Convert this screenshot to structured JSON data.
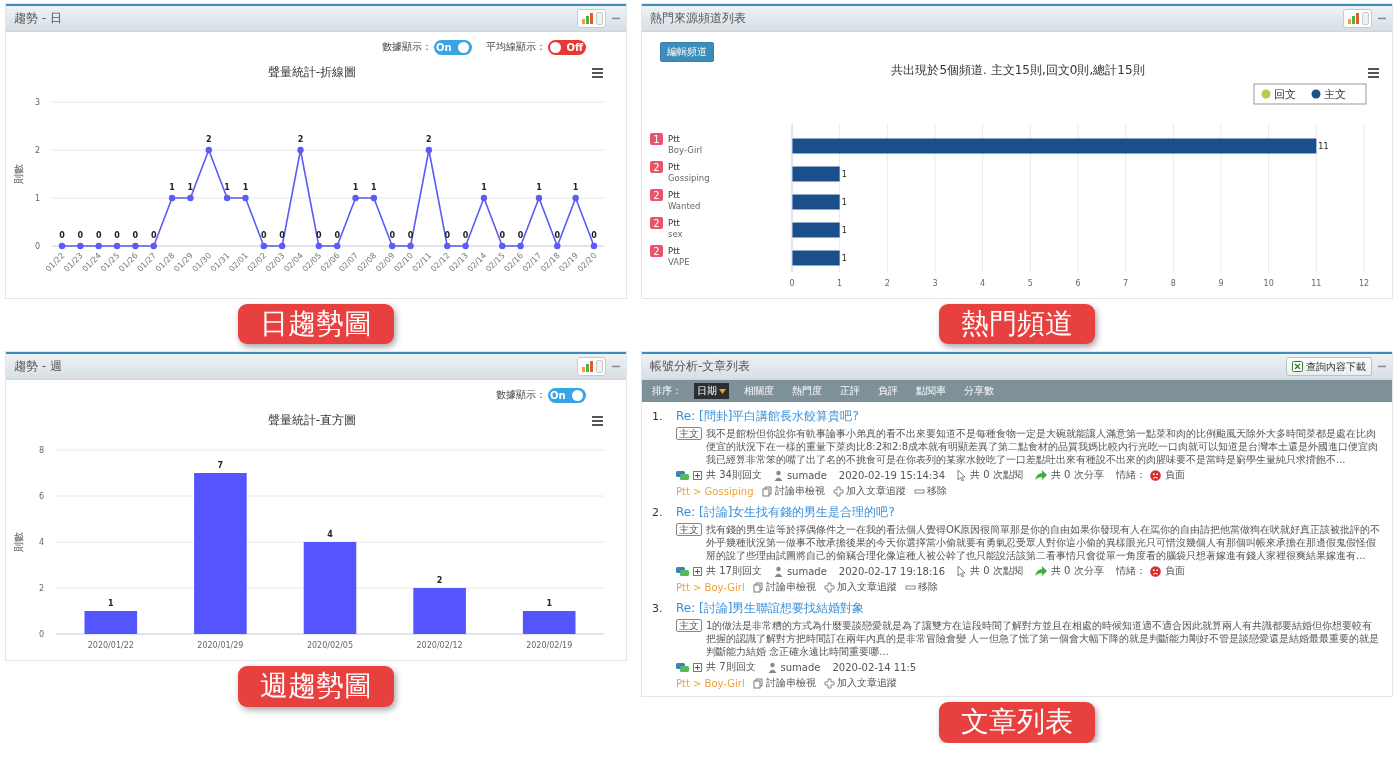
{
  "panels": [
    {
      "kind": "line_trend",
      "title": "趨勢 - 日",
      "toggles": [
        {
          "label": "數據顯示：",
          "on": true,
          "text": "On"
        },
        {
          "label": "平均線顯示：",
          "on": false,
          "text": "Off"
        }
      ],
      "chart_data": {
        "type": "line",
        "title": "聲量統計-折線圖",
        "ylabel": "則數",
        "categories": [
          "01/22",
          "01/23",
          "01/24",
          "01/25",
          "01/26",
          "01/27",
          "01/28",
          "01/29",
          "01/30",
          "01/31",
          "02/01",
          "02/02",
          "02/03",
          "02/04",
          "02/05",
          "02/06",
          "02/07",
          "02/08",
          "02/09",
          "02/10",
          "02/11",
          "02/12",
          "02/13",
          "02/14",
          "02/15",
          "02/16",
          "02/17",
          "02/18",
          "02/19",
          "02/20"
        ],
        "values": [
          0,
          0,
          0,
          0,
          0,
          0,
          1,
          1,
          2,
          1,
          1,
          0,
          0,
          2,
          0,
          0,
          1,
          1,
          0,
          0,
          2,
          0,
          0,
          1,
          0,
          0,
          1,
          0,
          1,
          0
        ],
        "yticks": [
          0,
          1,
          2,
          3
        ],
        "ylim": [
          0,
          3
        ],
        "grid": true,
        "marker": true,
        "data_labels": true
      },
      "caption": "日趨勢圖"
    },
    {
      "kind": "channel_bars",
      "title": "熱門來源頻道列表",
      "button": "編輯頻道",
      "channels": [
        {
          "rank": "1",
          "site": "Ptt"
        },
        {
          "rank": "2",
          "site": "Ptt"
        },
        {
          "rank": "2",
          "site": "Ptt"
        },
        {
          "rank": "2",
          "site": "Ptt"
        },
        {
          "rank": "2",
          "site": "Ptt"
        }
      ],
      "chart_data": {
        "type": "bar",
        "orientation": "horizontal",
        "stacked": true,
        "title": "共出現於5個頻道. 主文15則,回文0則,總計15則",
        "categories": [
          "Boy-Girl",
          "Gossiping",
          "Wanted",
          "sex",
          "VAPE"
        ],
        "series": [
          {
            "name": "回文",
            "color": "#b5cc4f",
            "values": [
              0,
              0,
              0,
              0,
              0
            ],
            "value_labels": [
              null,
              null,
              null,
              null,
              null
            ]
          },
          {
            "name": "主文",
            "color": "#1b4f8c",
            "values": [
              11,
              1,
              1,
              1,
              1
            ],
            "value_labels": [
              "11",
              "1",
              "1",
              "1",
              "1"
            ]
          }
        ],
        "xticks": [
          0,
          1,
          2,
          3,
          4,
          5,
          6,
          7,
          8,
          9,
          10,
          11,
          12
        ],
        "xlim": [
          0,
          12
        ],
        "grid": true
      },
      "caption": "熱門頻道"
    },
    {
      "kind": "week_bars",
      "title": "趨勢 - 週",
      "toggles": [
        {
          "label": "數據顯示：",
          "on": true,
          "text": "On"
        }
      ],
      "chart_data": {
        "type": "bar",
        "title": "聲量統計-直方圖",
        "ylabel": "則數",
        "categories": [
          "2020/01/22",
          "2020/01/29",
          "2020/02/05",
          "2020/02/12",
          "2020/02/19"
        ],
        "values": [
          1,
          7,
          4,
          2,
          1
        ],
        "yticks": [
          0,
          2,
          4,
          6,
          8
        ],
        "ylim": [
          0,
          8
        ],
        "grid": true,
        "data_labels": true
      },
      "caption": "週趨勢圖"
    },
    {
      "kind": "articles",
      "title": "帳號分析-文章列表",
      "download": "查詢內容下載",
      "sort_label": "排序：",
      "sort_options": [
        {
          "label": "日期",
          "selected": true
        },
        {
          "label": "相關度",
          "selected": false
        },
        {
          "label": "熱門度",
          "selected": false
        },
        {
          "label": "正評",
          "selected": false
        },
        {
          "label": "負評",
          "selected": false
        },
        {
          "label": "點閱率",
          "selected": false
        },
        {
          "label": "分享數",
          "selected": false
        }
      ],
      "articles": [
        {
          "number": "1.",
          "title": "Re: [問卦]平白講館長水餃算貴吧?",
          "tag": "主文",
          "excerpt": [
            "我不是館粉但你說你有軌事論事小弟真的看不出來要知道不是每種食物一定是大碗就能讓人滿意第一點菜和肉的比例颱風天除外大多時間菜都是處在比肉便宜的狀況下在一樣的重量下菜肉比8:2和2:8成本就有明顯差異了第二點食材的品質我媽比較內行光吃一口肉就可以知道是台灣本土還是外國進口便宜肉我已經算非常笨的嘴了出了名的不挑食可是在你表列的某家水餃吃了一口差點吐出來有種說不出來的肉腥味要不是當時是窮學生量純只求揹飽不..."
          ],
          "replies": "共 34則回文",
          "author": "sumade",
          "date": "2020-02-19 15:14:34",
          "clicks": "共 0 次點閱",
          "shares": "共 0 次分享",
          "mood_label": "情緒：",
          "mood": "負面",
          "source": "Ptt > Gossiping",
          "actions": [
            "討論串檢視",
            "加入文章追蹤",
            "移除"
          ]
        },
        {
          "number": "2.",
          "title": "Re: [討論]女生找有錢的男生是合理的吧?",
          "tag": "主文",
          "excerpt": [
            "找有錢的男生這等於擇偶條件之一在我的看法個人覺得OK原因很簡單那是你的自由如果你發現有人在罵你的自由請把他當做狗在吠就好真正該被批評的不外乎幾種狀況第一做事不敢承擔後果的今天你選擇當小偷就要有勇氣忍受眾人對你這小偷的異樣眼光只可惜沒幾個人有那個叫帳來承擔在那邊假鬼假怪假掰的說了些理由試圖將自己的偷竊合理化像這種人被公幹了也只能說活該第二看事情只會從單一角度看的腦袋只想著嫁進有錢人家裡很爽結果嫁進有..."
          ],
          "replies": "共 17則回文",
          "author": "sumade",
          "date": "2020-02-17 19:18:16",
          "clicks": "共 0 次點閱",
          "shares": "共 0 次分享",
          "mood_label": "情緒：",
          "mood": "負面",
          "source": "Ptt > Boy-Girl",
          "actions": [
            "討論串檢視",
            "加入文章追蹤",
            "移除"
          ]
        },
        {
          "number": "3.",
          "title": "Re: [討論]男生聯誼想要找結婚對象",
          "tag": "主文",
          "excerpt": [
            "1的做法是非常糟的方式為什麼要談戀愛就是為了讓雙方在這段時間了解對方並且在相處的時候知道適不適合因此就算兩人有共識都要結婚但你想要較有把握的認識了解對方把時間訂在兩年內真的是非常冒險會變",
            "人一但急了慌了第一個會大幅下降的就是判斷能力剛好不管是談戀愛還是結婚最最重要的就是判斷能力結婚",
            "念正確永遠比時間重要哪..."
          ],
          "replies": "共 7則回文",
          "author": "sumade",
          "date": "2020-02-14 11:5",
          "source": "Ptt > Boy-Girl",
          "actions": [
            "討論串檢視",
            "加入文章追蹤"
          ]
        }
      ],
      "caption": "文章列表"
    }
  ]
}
